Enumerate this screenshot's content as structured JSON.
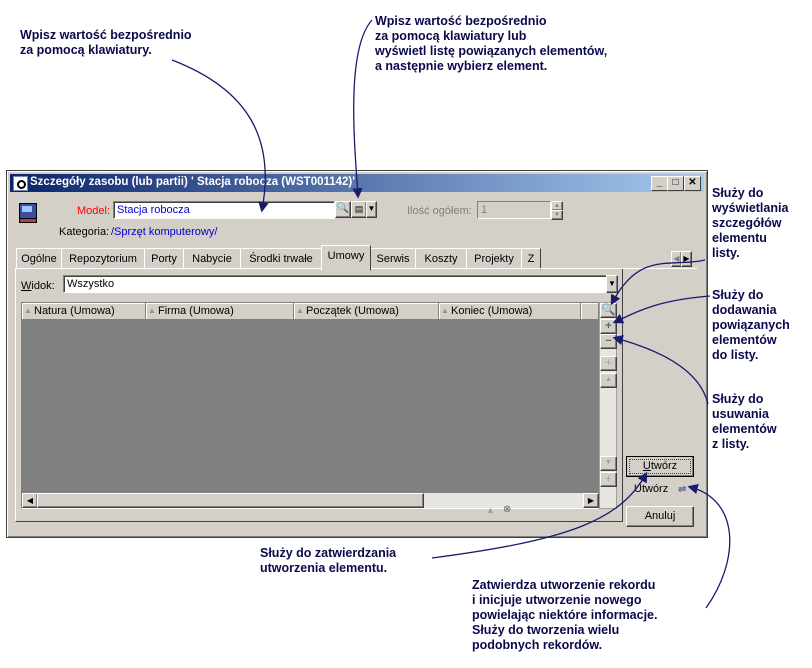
{
  "annotations": {
    "keyboard_entry": "Wpisz wartość bezpośrednio\nza pomocą klawiatury.",
    "keyboard_or_list": "Wpisz wartość bezpośrednio\nza pomocą klawiatury lub\nwyświetl listę powiązanych  elementów,\na następnie wybierz element.",
    "detail_view": "Służy do\nwyświetlania\nszczegółów\nelementu\nlisty.",
    "add_linked": "Służy do\ndodawania\npowiązanych\nelementów\ndo listy.",
    "remove": "Służy do\nusuwania\nelementów\nz listy.",
    "confirm_create": "Służy do zatwierdzania\nutworzenia elementu.",
    "create_duplicate": "Zatwierdza utworzenie rekordu\ni inicjuje utworzenie nowego\npowielając niektóre informacje.\nSłuży do tworzenia wielu\npodobnych rekordów."
  },
  "window": {
    "title": "Szczegóły zasobu (lub partii) ' Stacja robocza (WST001142)'",
    "minimize": "_",
    "maximize": "□",
    "close": "✕"
  },
  "form": {
    "model_label": "Model:",
    "model_value": "Stacja robocza",
    "quantity_label": "Ilość ogółem:",
    "quantity_value": "1",
    "category_label": "Kategoria:",
    "category_value": "/Sprzęt komputerowy/"
  },
  "tabs": [
    {
      "label": "Ogólne"
    },
    {
      "label": "Repozytorium"
    },
    {
      "label": "Porty"
    },
    {
      "label": "Nabycie"
    },
    {
      "label": "Środki trwałe"
    },
    {
      "label": "Umowy"
    },
    {
      "label": "Serwis"
    },
    {
      "label": "Koszty"
    },
    {
      "label": "Projekty"
    },
    {
      "label": "Z"
    }
  ],
  "active_tab": "Umowy",
  "view": {
    "label": "Widok:",
    "value": "Wszystko"
  },
  "columns": [
    "Natura (Umowa)",
    "Firma (Umowa)",
    "Początek (Umowa)",
    "Koniec (Umowa)"
  ],
  "buttons": {
    "create": "Utwórz",
    "create_dup": "Utwórz",
    "cancel": "Anuluj"
  },
  "colors": {
    "title_start": "#0a246a",
    "title_end": "#a6caf0",
    "model_label": "#ff0000",
    "link_blue": "#0000cc",
    "list_bg": "#808080",
    "annotation_text": "#0a0a4a",
    "arrow": "#1a1a6e"
  }
}
